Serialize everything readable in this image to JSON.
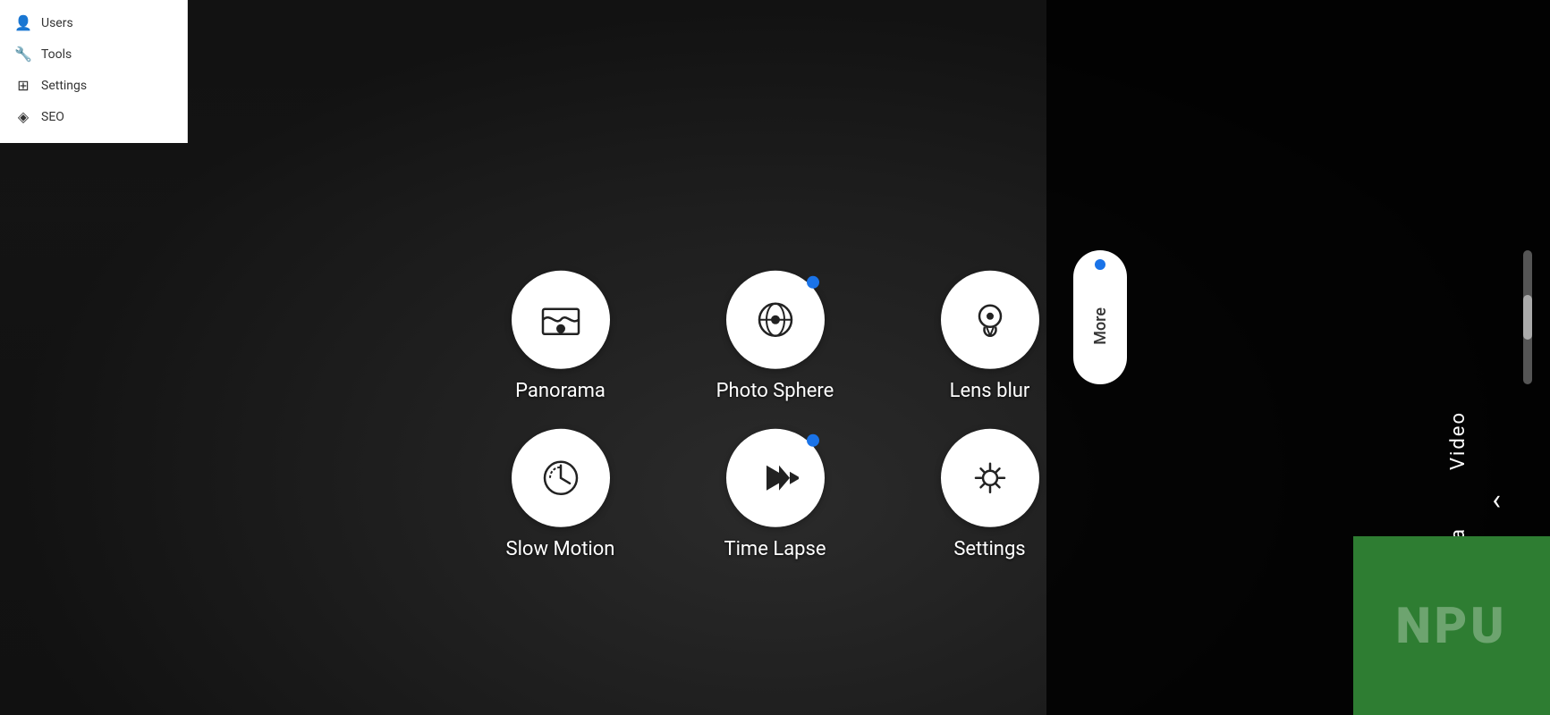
{
  "sidebar": {
    "items": [
      {
        "id": "users",
        "label": "Users",
        "icon": "👤"
      },
      {
        "id": "tools",
        "label": "Tools",
        "icon": "🔧"
      },
      {
        "id": "settings",
        "label": "Settings",
        "icon": "⊞"
      },
      {
        "id": "seo",
        "label": "SEO",
        "icon": "◈"
      }
    ]
  },
  "camera_modes": {
    "row1": [
      {
        "id": "panorama",
        "label": "Panorama",
        "has_dot": false
      },
      {
        "id": "photo-sphere",
        "label": "Photo Sphere",
        "has_dot": true
      },
      {
        "id": "lens-blur",
        "label": "Lens blur",
        "has_dot": false
      }
    ],
    "row2": [
      {
        "id": "slow-motion",
        "label": "Slow Motion",
        "has_dot": false
      },
      {
        "id": "time-lapse",
        "label": "Time Lapse",
        "has_dot": true
      },
      {
        "id": "settings",
        "label": "Settings",
        "has_dot": false
      }
    ]
  },
  "right_panel": {
    "more_label": "More",
    "video_label": "Video",
    "camera_label": "Camera",
    "back_arrow": "‹",
    "more_dot_color": "#1a73e8",
    "npu_text": "NPU"
  }
}
